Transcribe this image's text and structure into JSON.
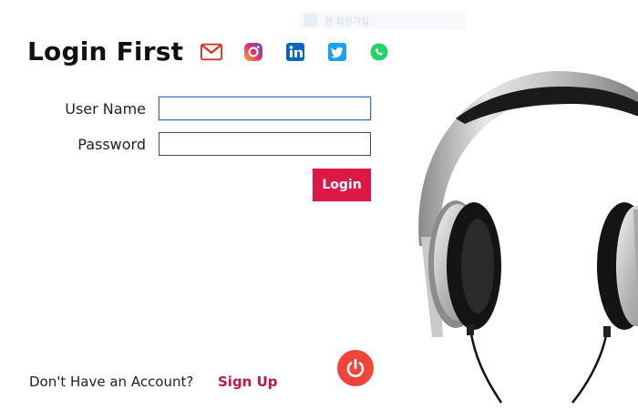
{
  "window": {
    "faint_bar_text": "한 회원가입"
  },
  "header": {
    "title": "Login First"
  },
  "social": [
    {
      "name": "gmail",
      "icon": "gmail-icon",
      "color": "#d93025"
    },
    {
      "name": "instagram",
      "icon": "instagram-icon",
      "color": "#c13584"
    },
    {
      "name": "linkedin",
      "icon": "linkedin-icon",
      "color": "#0a66c2"
    },
    {
      "name": "twitter",
      "icon": "twitter-icon",
      "color": "#1da1f2"
    },
    {
      "name": "whatsapp",
      "icon": "whatsapp-icon",
      "color": "#25d366"
    }
  ],
  "form": {
    "username_label": "User Name",
    "username_value": "",
    "password_label": "Password",
    "password_value": "",
    "login_label": "Login"
  },
  "footer": {
    "no_account_text": "Don't Have an Account?",
    "signup_label": "Sign Up"
  },
  "colors": {
    "accent": "#dd1847",
    "signup": "#c7134a",
    "power": "#f0443c"
  },
  "icons": {
    "power": "power-icon",
    "image": "headphones-image"
  }
}
